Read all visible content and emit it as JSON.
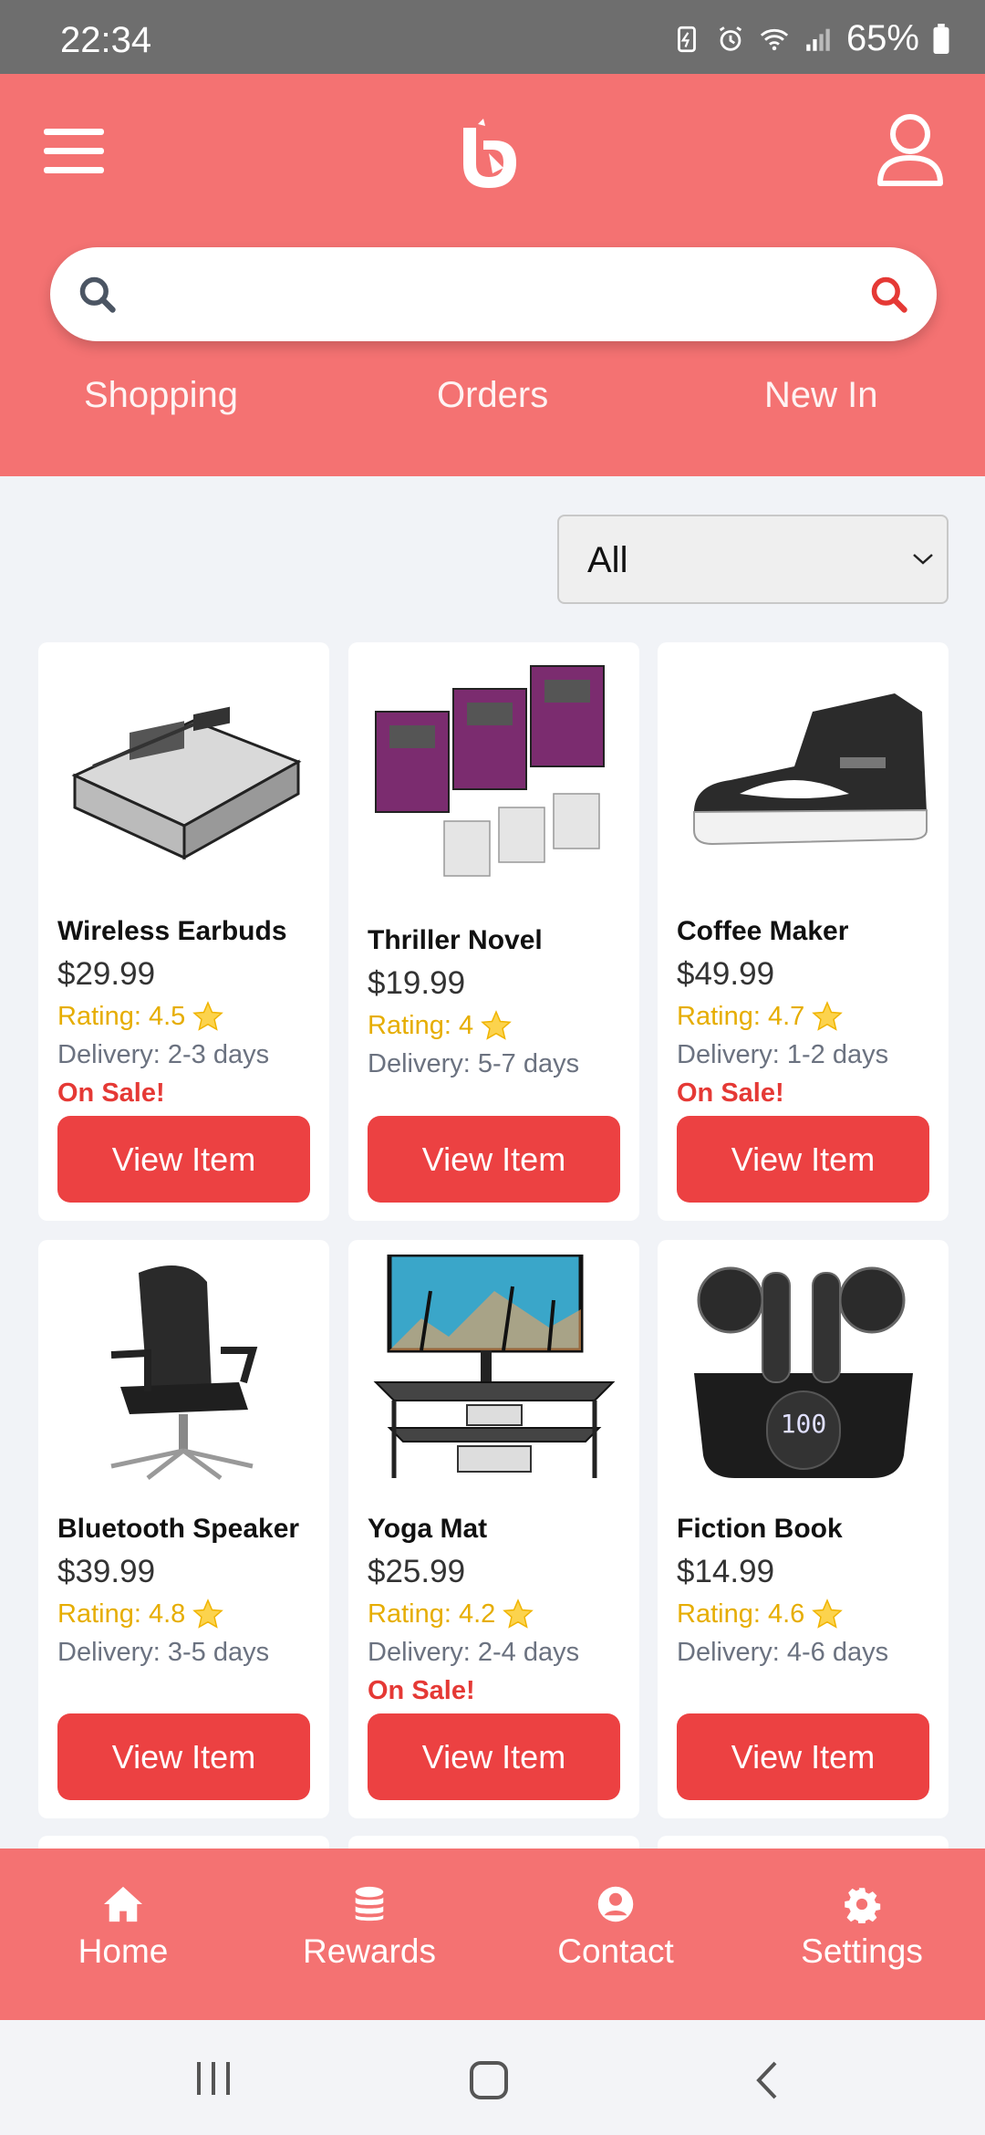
{
  "status_bar": {
    "time": "22:34",
    "battery": "65%"
  },
  "header": {
    "menu_icon": "hamburger-menu-icon",
    "logo_icon": "brand-logo-icon",
    "profile_icon": "user-profile-icon"
  },
  "search": {
    "placeholder": "",
    "value": ""
  },
  "tabs": [
    {
      "label": "Shopping"
    },
    {
      "label": "Orders"
    },
    {
      "label": "New In"
    }
  ],
  "filter": {
    "selected": "All"
  },
  "products": [
    {
      "name": "Wireless Earbuds",
      "price": "$29.99",
      "rating": "Rating: 4.5",
      "delivery": "Delivery: 2-3 days",
      "sale": "On Sale!",
      "button": "View Item"
    },
    {
      "name": "Thriller Novel",
      "price": "$19.99",
      "rating": "Rating: 4",
      "delivery": "Delivery: 5-7 days",
      "sale": "",
      "button": "View Item"
    },
    {
      "name": "Coffee Maker",
      "price": "$49.99",
      "rating": "Rating: 4.7",
      "delivery": "Delivery: 1-2 days",
      "sale": "On Sale!",
      "button": "View Item"
    },
    {
      "name": "Bluetooth Speaker",
      "price": "$39.99",
      "rating": "Rating: 4.8",
      "delivery": "Delivery: 3-5 days",
      "sale": "",
      "button": "View Item"
    },
    {
      "name": "Yoga Mat",
      "price": "$25.99",
      "rating": "Rating: 4.2",
      "delivery": "Delivery: 2-4 days",
      "sale": "On Sale!",
      "button": "View Item"
    },
    {
      "name": "Fiction Book",
      "price": "$14.99",
      "rating": "Rating: 4.6",
      "delivery": "Delivery: 4-6 days",
      "sale": "",
      "button": "View Item"
    }
  ],
  "bottom_nav": [
    {
      "label": "Home",
      "icon": "home-icon"
    },
    {
      "label": "Rewards",
      "icon": "coins-icon"
    },
    {
      "label": "Contact",
      "icon": "user-circle-icon"
    },
    {
      "label": "Settings",
      "icon": "gear-icon"
    }
  ],
  "colors": {
    "header": "#f47272",
    "button": "#ec4142",
    "sale": "#e53935",
    "rating": "#e6ad00",
    "background": "#f1f3f7"
  }
}
